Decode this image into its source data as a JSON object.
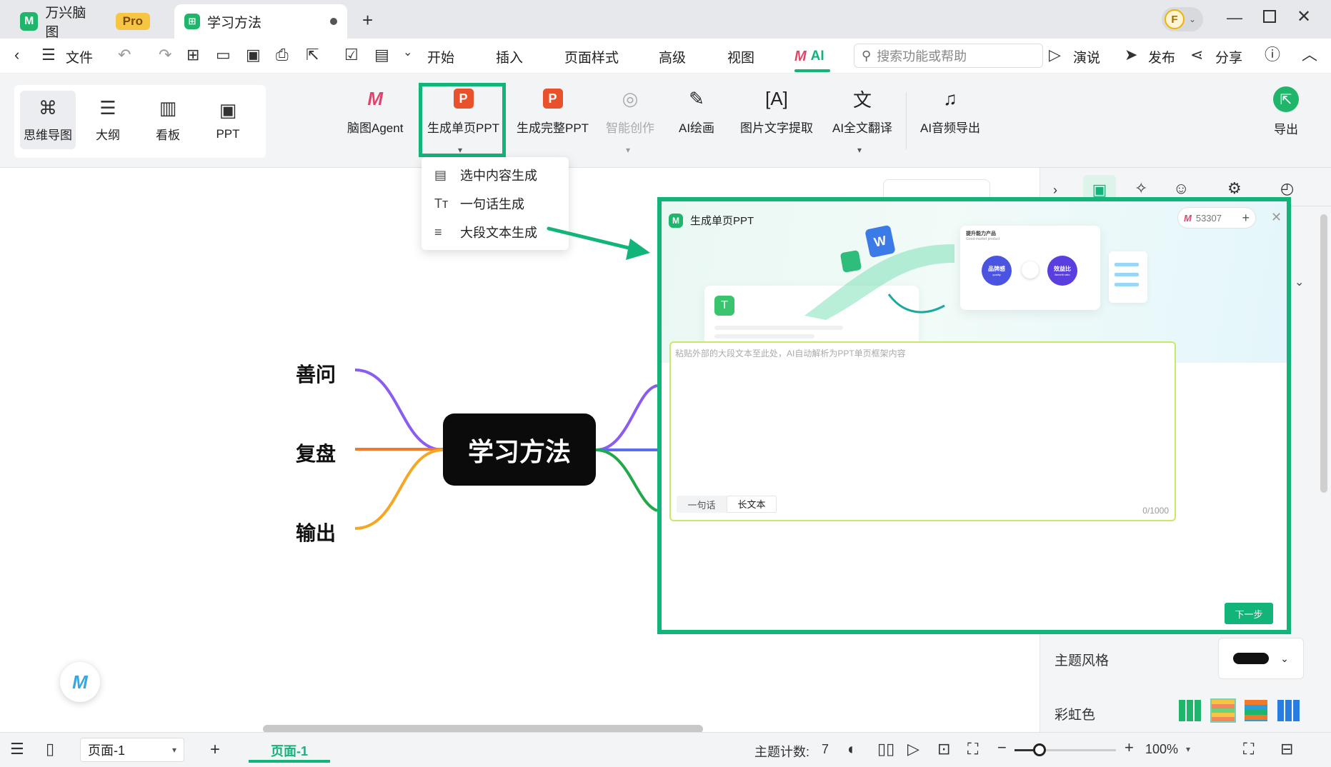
{
  "app": {
    "tabs": [
      {
        "label": "万兴脑图",
        "badge": "Pro"
      },
      {
        "label": "学习方法"
      }
    ],
    "avatar_letter": "F",
    "window_controls": [
      "minimize",
      "maximize",
      "close"
    ]
  },
  "menu": {
    "file": "文件",
    "items": [
      "开始",
      "插入",
      "页面样式",
      "高级",
      "视图",
      "AI"
    ],
    "search_placeholder": "搜索功能或帮助",
    "present": "演说",
    "publish": "发布",
    "share": "分享"
  },
  "ribbon": {
    "views": [
      "思维导图",
      "大纲",
      "看板",
      "PPT"
    ],
    "tools": [
      "脑图Agent",
      "生成单页PPT",
      "生成完整PPT",
      "智能创作",
      "AI绘画",
      "图片文字提取",
      "AI全文翻译",
      "AI音频导出"
    ],
    "export": "导出"
  },
  "dropdown": {
    "items": [
      "选中内容生成",
      "一句话生成",
      "大段文本生成"
    ]
  },
  "mindmap": {
    "root": "学习方法",
    "branches": [
      "善问",
      "复盘",
      "输出"
    ],
    "colors": {
      "purple": "#8a5cf0",
      "orange": "#f07a2c",
      "yellow": "#f5a623",
      "green": "#20a84a",
      "blue": "#5b6cf0"
    }
  },
  "dialog": {
    "title": "生成单页PPT",
    "credits": "53307",
    "textarea_placeholder": "粘贴外部的大段文本至此处，AI自动解析为PPT单页框架内容",
    "tab_one_sentence": "一句话",
    "tab_long_text": "长文本",
    "counter": "0/1000",
    "next_button": "下一步",
    "illustration": {
      "card_title": "提升能力产品",
      "card_subtitle": "Good-market product",
      "bubble_left": "品牌感",
      "bubble_left_sub": "quality",
      "bubble_right": "效益比",
      "bubble_right_sub": "Benefit ratio"
    }
  },
  "right_panel": {
    "theme_style_label": "主题风格",
    "rainbow_label": "彩虹色"
  },
  "status": {
    "page_select": "页面-1",
    "page_tab": "页面-1",
    "topic_count_label": "主题计数:",
    "topic_count": "7",
    "zoom": "100%"
  },
  "accent": "#13b47a"
}
